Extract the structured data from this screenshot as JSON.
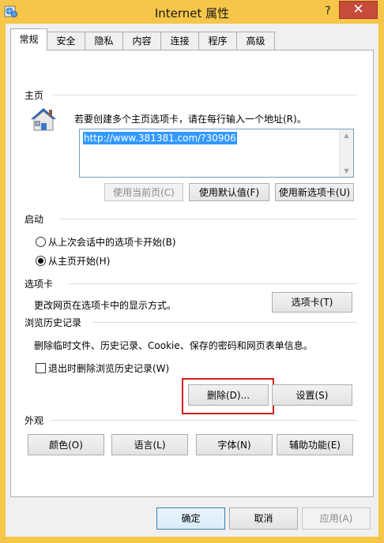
{
  "window": {
    "title": "Internet 属性",
    "help_label": "?",
    "close_label": "✕"
  },
  "tabs": [
    "常规",
    "安全",
    "隐私",
    "内容",
    "连接",
    "程序",
    "高级"
  ],
  "homepage": {
    "section_title": "主页",
    "instruction": "若要创建多个主页选项卡，请在每行输入一个地址(R)。",
    "url": "http://www.381381.com/?30906",
    "buttons": {
      "use_current": "使用当前页(C)",
      "use_default": "使用默认值(F)",
      "use_new_tab": "使用新选项卡(U)"
    }
  },
  "startup": {
    "section_title": "启动",
    "options": [
      "从上次会话中的选项卡开始(B)",
      "从主页开始(H)"
    ],
    "selected_index": 1
  },
  "tabs_section": {
    "section_title": "选项卡",
    "description": "更改网页在选项卡中的显示方式。",
    "button": "选项卡(T)"
  },
  "history": {
    "section_title": "浏览历史记录",
    "description": "删除临时文件、历史记录、Cookie、保存的密码和网页表单信息。",
    "checkbox_label": "退出时删除浏览历史记录(W)",
    "checkbox_checked": false,
    "delete_button": "删除(D)...",
    "settings_button": "设置(S)"
  },
  "appearance": {
    "section_title": "外观",
    "buttons": [
      "颜色(O)",
      "语言(L)",
      "字体(N)",
      "辅助功能(E)"
    ]
  },
  "footer": {
    "ok": "确定",
    "cancel": "取消",
    "apply": "应用(A)"
  },
  "colors": {
    "titlebar": "#f5c64a",
    "close_button": "#c74b3a",
    "highlight": "#d1201f",
    "selection": "#3399ff"
  }
}
